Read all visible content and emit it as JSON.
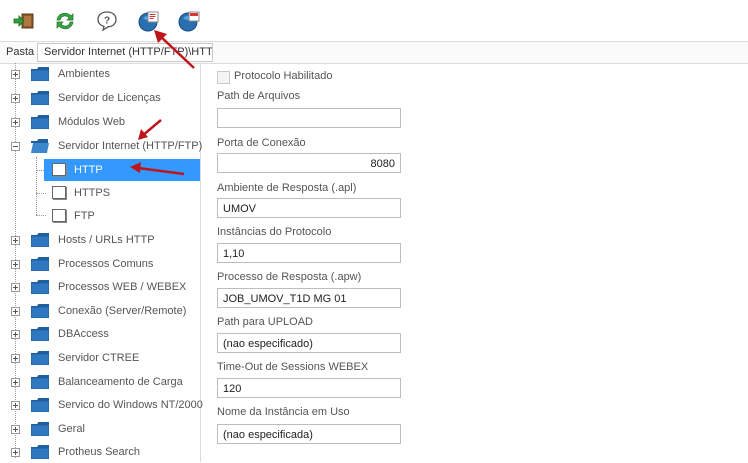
{
  "toolbar": {
    "buttons": [
      {
        "name": "exit-icon",
        "color": "#2e8b57"
      },
      {
        "name": "refresh-icon",
        "color": "#2e9e3a"
      },
      {
        "name": "help-icon",
        "color": "#555555"
      },
      {
        "name": "edit-icon",
        "color": "#2a6fb0"
      },
      {
        "name": "config-icon",
        "color": "#2a6fb0"
      }
    ]
  },
  "path": {
    "label": "Pasta",
    "value": "Servidor Internet (HTTP/FTP)\\HTTP"
  },
  "tree": {
    "items": [
      {
        "label": "Ambientes"
      },
      {
        "label": "Servidor de Licenças"
      },
      {
        "label": "Módulos Web"
      },
      {
        "label": "Servidor Internet (HTTP/FTP)",
        "expanded": true,
        "children": [
          {
            "label": "HTTP",
            "selected": true
          },
          {
            "label": "HTTPS"
          },
          {
            "label": "FTP"
          }
        ]
      },
      {
        "label": "Hosts / URLs HTTP"
      },
      {
        "label": "Processos Comuns"
      },
      {
        "label": "Processos WEB / WEBEX"
      },
      {
        "label": "Conexão (Server/Remote)"
      },
      {
        "label": "DBAccess"
      },
      {
        "label": "Servidor CTREE"
      },
      {
        "label": "Balanceamento de Carga"
      },
      {
        "label": "Servico do Windows NT/2000"
      },
      {
        "label": "Geral"
      },
      {
        "label": "Protheus Search"
      }
    ]
  },
  "form": {
    "protocolo_habilitado": {
      "label": "Protocolo Habilitado",
      "checked": false
    },
    "path_arquivos": {
      "label": "Path de Arquivos",
      "value": ""
    },
    "porta_conexao": {
      "label": "Porta de Conexão",
      "value": "8080"
    },
    "ambiente_resposta": {
      "label": "Ambiente de Resposta (.apl)",
      "value": "UMOV"
    },
    "instancias": {
      "label": "Instâncias do Protocolo",
      "value": "1,10"
    },
    "processo_resposta": {
      "label": "Processo de Resposta (.apw)",
      "value": "JOB_UMOV_T1D MG 01"
    },
    "path_upload": {
      "label": "Path para UPLOAD",
      "value": "(nao especificado)"
    },
    "timeout_webex": {
      "label": "Time-Out de Sessions WEBEX",
      "value": "120"
    },
    "nome_instancia": {
      "label": "Nome da Instância em Uso",
      "value": "(nao especificada)"
    }
  },
  "colors": {
    "selection": "#3399ff",
    "folder": "#1f5f9e",
    "annotation_arrow": "#c0141b"
  }
}
